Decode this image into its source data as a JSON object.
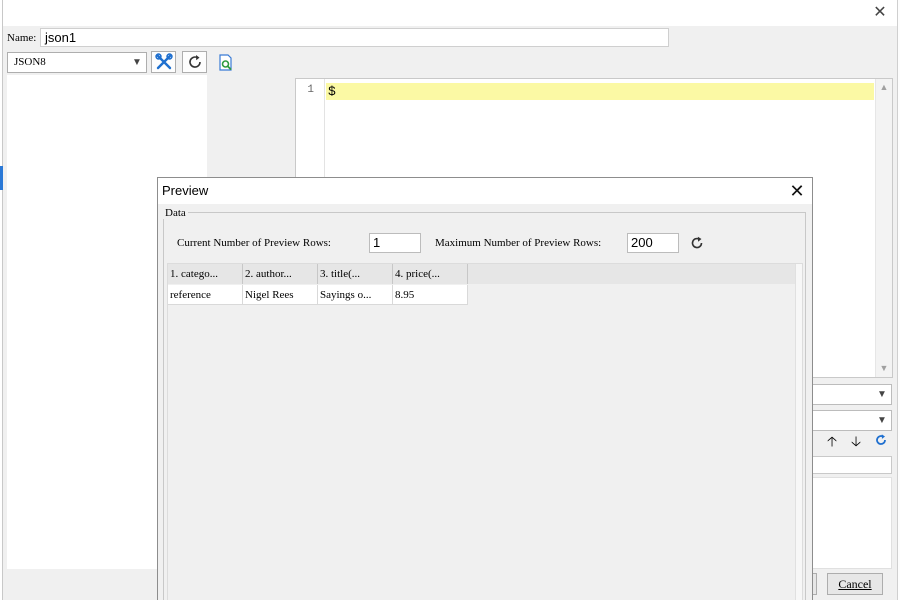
{
  "form": {
    "name_label": "Name:",
    "name_value": "json1",
    "format_value": "JSON8",
    "cancel_label": "Cancel"
  },
  "editor": {
    "line_number": "1",
    "content": "$"
  },
  "preview": {
    "title": "Preview",
    "group_label": "Data",
    "current_rows_label": "Current Number of Preview Rows:",
    "current_rows_value": "1",
    "max_rows_label": "Maximum Number of Preview Rows:",
    "max_rows_value": "200",
    "columns": [
      "1. catego...",
      "2. author...",
      "3. title(...",
      "4. price(..."
    ],
    "rows": [
      [
        "reference",
        "Nigel Rees",
        "Sayings o...",
        "8.95"
      ]
    ]
  },
  "icons": {
    "close": "close-icon",
    "tools": "tools-icon",
    "refresh": "refresh-icon",
    "preview": "preview-search-icon",
    "arrow_up": "arrow-up-icon",
    "arrow_down": "arrow-down-icon"
  },
  "colors": {
    "current_line_highlight": "#fbf9a4",
    "accent_blue": "#1e6fcf"
  }
}
